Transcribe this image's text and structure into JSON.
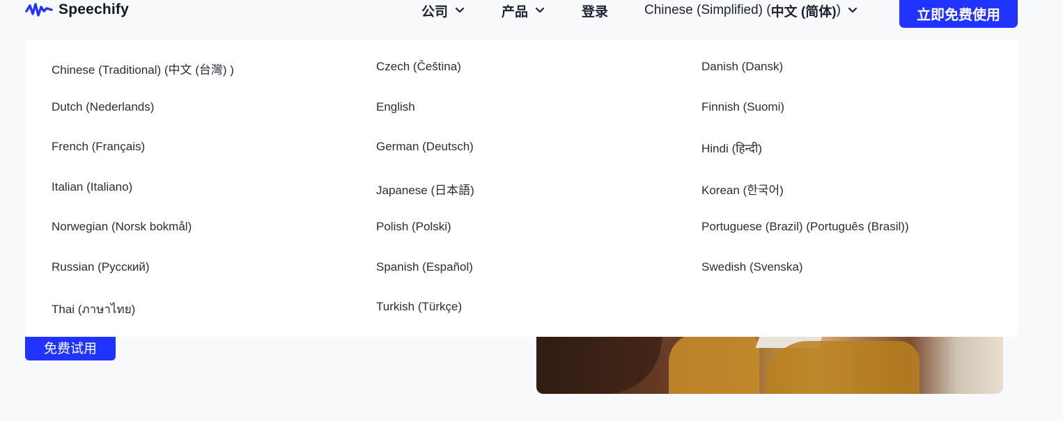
{
  "header": {
    "logo_text": "Speechify",
    "nav": {
      "company": "公司",
      "products": "产品",
      "login": "登录",
      "language_prefix": "Chinese (Simplified) (",
      "language_native": "中文 (简体)",
      "language_suffix": ")"
    },
    "cta_label": "立即免费使用"
  },
  "dropdown": {
    "columns": [
      [
        "Chinese (Traditional) (中文 (台灣) )",
        "Dutch (Nederlands)",
        "French (Français)",
        "Italian (Italiano)",
        "Norwegian (Norsk bokmål)",
        "Russian (Русский)",
        "Thai (ภาษาไทย)"
      ],
      [
        "Czech (Čeština)",
        "English",
        "German (Deutsch)",
        "Japanese (日本語)",
        "Polish (Polski)",
        "Spanish (Español)",
        "Turkish (Türkçe)"
      ],
      [
        "Danish (Dansk)",
        "Finnish (Suomi)",
        "Hindi (हिन्दी)",
        "Korean (한국어)",
        "Portuguese (Brazil) (Português (Brasil))",
        "Swedish (Svenska)"
      ]
    ]
  },
  "content": {
    "try_button": "免费试用"
  },
  "colors": {
    "accent": "#2133ff",
    "background": "#f7f9fb",
    "dropdown_bg": "#ffffff"
  },
  "icons": {
    "logo": "speechify-waveform-icon",
    "chevron": "chevron-down-icon"
  }
}
